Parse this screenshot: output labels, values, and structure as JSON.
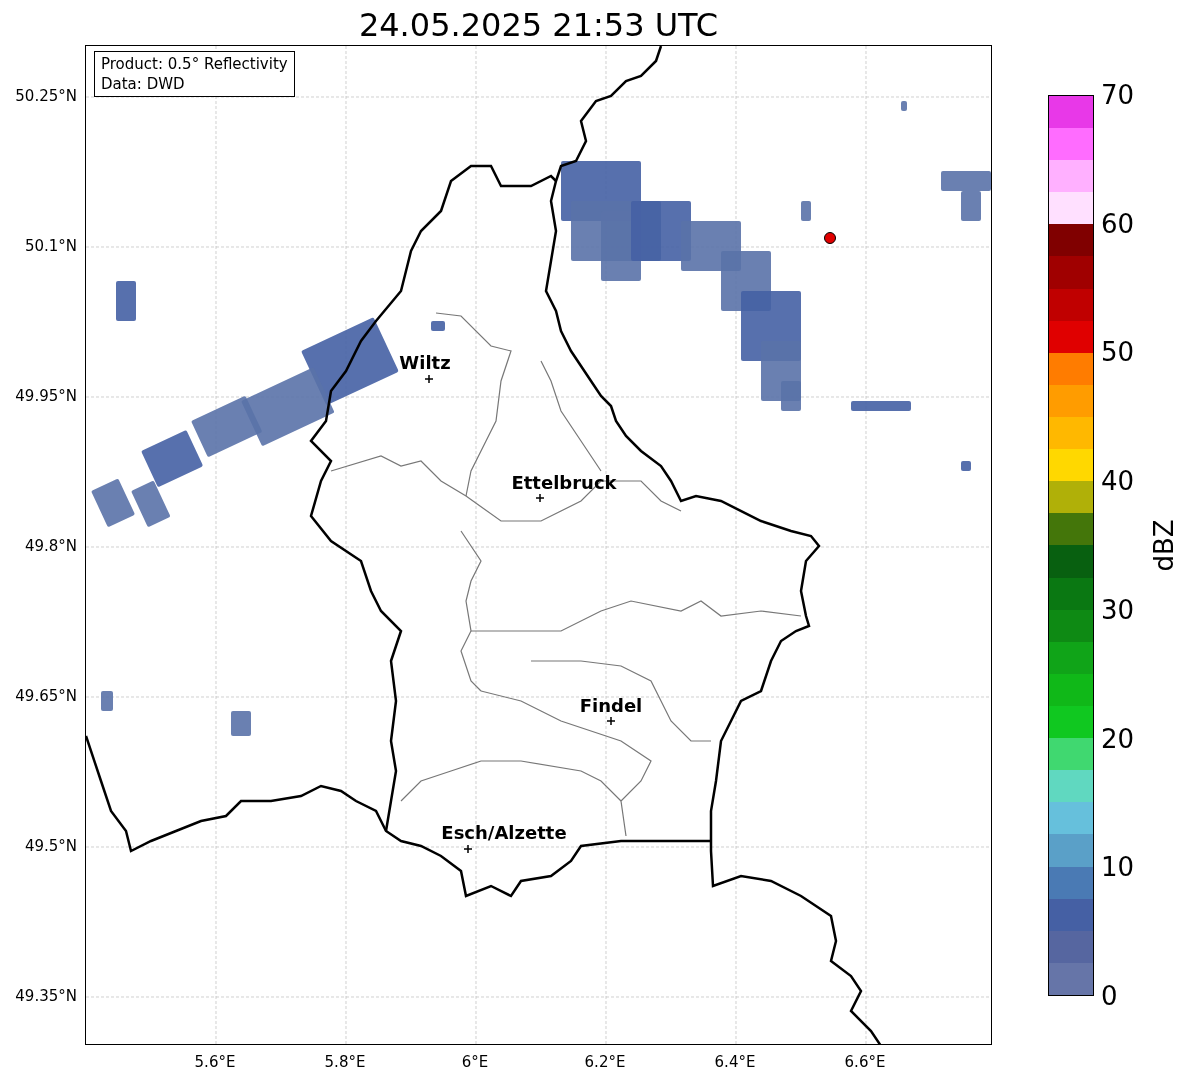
{
  "title": "24.05.2025 21:53 UTC",
  "info_box": [
    "Product: 0.5° Reflectivity",
    "Data: DWD"
  ],
  "map": {
    "xticks": [
      "5.6°E",
      "5.8°E",
      "6°E",
      "6.2°E",
      "6.4°E",
      "6.6°E"
    ],
    "yticks": [
      "50.25°N",
      "50.1°N",
      "49.95°N",
      "49.8°N",
      "49.65°N",
      "49.5°N",
      "49.35°N"
    ],
    "cities": [
      {
        "name": "Wiltz"
      },
      {
        "name": "Ettelbruck"
      },
      {
        "name": "Findel"
      },
      {
        "name": "Esch/Alzette"
      }
    ]
  },
  "colorbar": {
    "label": "dBZ",
    "ticks": [
      "70",
      "60",
      "50",
      "40",
      "30",
      "20",
      "10",
      "0"
    ],
    "segments": [
      {
        "color": "#6675a8"
      },
      {
        "color": "#5666a0"
      },
      {
        "color": "#4560a4"
      },
      {
        "color": "#4a7ab4"
      },
      {
        "color": "#5aa0c8"
      },
      {
        "color": "#66c0dc"
      },
      {
        "color": "#60d8c0"
      },
      {
        "color": "#40d870"
      },
      {
        "color": "#10c820"
      },
      {
        "color": "#10b818"
      },
      {
        "color": "#10a418"
      },
      {
        "color": "#0e8a14"
      },
      {
        "color": "#0a7812"
      },
      {
        "color": "#086010"
      },
      {
        "color": "#44760a"
      },
      {
        "color": "#b0b008"
      },
      {
        "color": "#ffd800"
      },
      {
        "color": "#ffb800"
      },
      {
        "color": "#ff9c00"
      },
      {
        "color": "#ff7c00"
      },
      {
        "color": "#e00000"
      },
      {
        "color": "#c00000"
      },
      {
        "color": "#a00000"
      },
      {
        "color": "#800000"
      },
      {
        "color": "#ffe0ff"
      },
      {
        "color": "#ffb0ff"
      },
      {
        "color": "#ff6cff"
      },
      {
        "color": "#e838e8"
      }
    ]
  }
}
